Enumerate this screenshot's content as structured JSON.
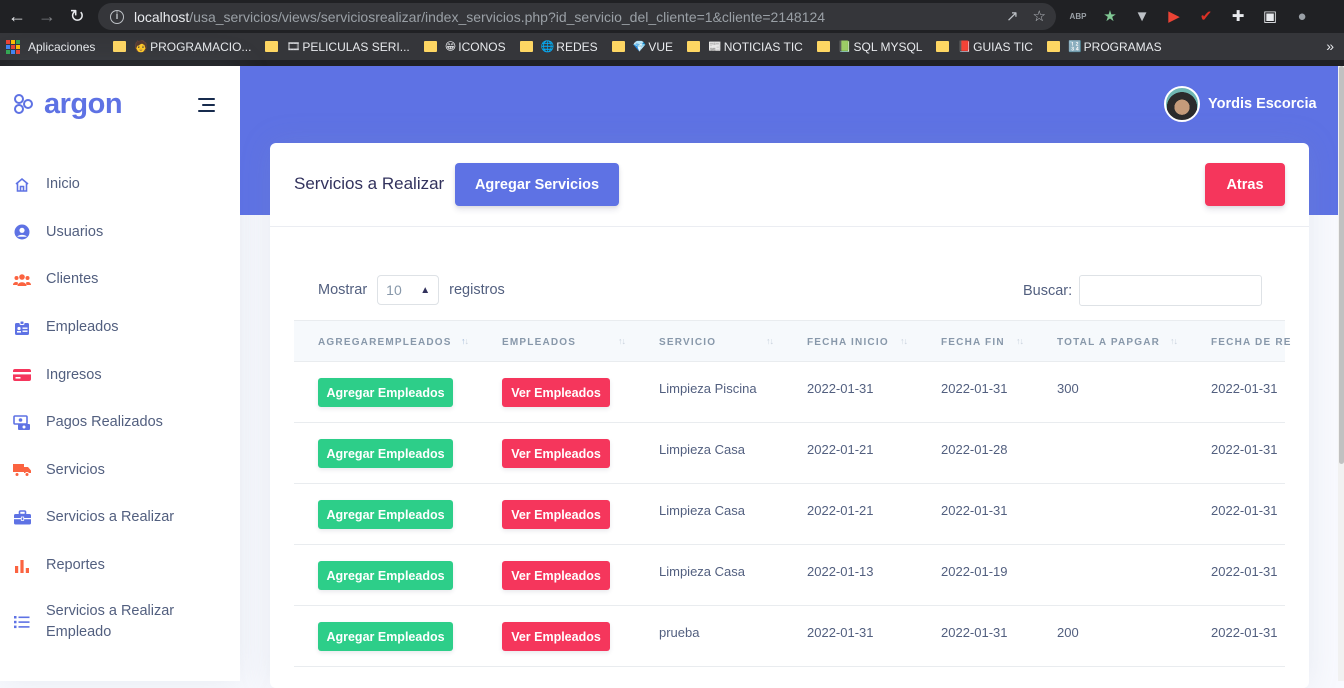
{
  "browser": {
    "url_host": "localhost",
    "url_path": "/usa_servicios/views/serviciosrealizar/index_servicios.php?id_servicio_del_cliente=1&cliente=2148124",
    "extensions": [
      {
        "name": "adblock-icon",
        "color": "#9aa0a6",
        "text": "ABP"
      },
      {
        "name": "star-extension-icon",
        "color": "#81c995",
        "text": "★"
      },
      {
        "name": "vue-devtools-icon",
        "color": "#bdc1c6",
        "text": "▼"
      },
      {
        "name": "video-extension-icon",
        "color": "#ea4335",
        "text": "▶"
      },
      {
        "name": "todo-extension-icon",
        "color": "#d93025",
        "text": "✔"
      },
      {
        "name": "puzzle-icon",
        "color": "#e8eaed",
        "text": "✚"
      },
      {
        "name": "sidepanel-icon",
        "color": "#e8eaed",
        "text": "▣"
      },
      {
        "name": "profile-icon",
        "color": "#9aa0a6",
        "text": "●"
      }
    ],
    "bookmarks": [
      {
        "label": "PROGRAMACIO...",
        "emoji": "🧑"
      },
      {
        "label": "PELICULAS SERI...",
        "emoji": "🎞"
      },
      {
        "label": "ICONOS",
        "emoji": "😁"
      },
      {
        "label": "REDES",
        "emoji": "🌐"
      },
      {
        "label": "VUE",
        "emoji": "💎"
      },
      {
        "label": "NOTICIAS TIC",
        "emoji": "📰"
      },
      {
        "label": "SQL MYSQL",
        "emoji": "📗"
      },
      {
        "label": "GUIAS TIC",
        "emoji": "📕"
      },
      {
        "label": "PROGRAMAS",
        "emoji": "🔢"
      }
    ],
    "apps_label": "Aplicaciones"
  },
  "brand": {
    "name": "argon"
  },
  "sidebar": {
    "items": [
      {
        "label": "Inicio",
        "icon": "home-icon",
        "color": "#5e72e4"
      },
      {
        "label": "Usuarios",
        "icon": "user-circle-icon",
        "color": "#5e72e4"
      },
      {
        "label": "Clientes",
        "icon": "users-icon",
        "color": "#fb6340"
      },
      {
        "label": "Empleados",
        "icon": "id-badge-icon",
        "color": "#5e72e4"
      },
      {
        "label": "Ingresos",
        "icon": "credit-card-icon",
        "color": "#f5365c"
      },
      {
        "label": "Pagos Realizados",
        "icon": "money-transfer-icon",
        "color": "#5e72e4"
      },
      {
        "label": "Servicios",
        "icon": "truck-icon",
        "color": "#fb6340"
      },
      {
        "label": "Servicios a Realizar",
        "icon": "briefcase-icon",
        "color": "#5e72e4"
      },
      {
        "label": "Reportes",
        "icon": "bar-chart-icon",
        "color": "#fb6340"
      },
      {
        "label": "Servicios a Realizar Empleado",
        "icon": "list-icon",
        "color": "#5e72e4"
      }
    ]
  },
  "header": {
    "user_name": "Yordis Escorcia"
  },
  "card": {
    "title": "Servicios a Realizar",
    "add_button": "Agregar Servicios",
    "back_button": "Atras",
    "show_label": "Mostrar",
    "page_length": "10",
    "records_label": "registros",
    "search_label": "Buscar:",
    "search_value": ""
  },
  "table": {
    "columns": [
      "AgregarEmpleados",
      "Empleados",
      "Servicio",
      "Fecha Inicio",
      "Fecha Fin",
      "Total a Papgar",
      "Fecha de Re"
    ],
    "add_employee_label": "Agregar Empleados",
    "view_employee_label": "Ver Empleados",
    "rows": [
      {
        "servicio": "Limpieza Piscina",
        "fecha_inicio": "2022-01-31",
        "fecha_fin": "2022-01-31",
        "total": "300",
        "fecha_re": "2022-01-31"
      },
      {
        "servicio": "Limpieza Casa",
        "fecha_inicio": "2022-01-21",
        "fecha_fin": "2022-01-28",
        "total": "",
        "fecha_re": "2022-01-31"
      },
      {
        "servicio": "Limpieza Casa",
        "fecha_inicio": "2022-01-21",
        "fecha_fin": "2022-01-31",
        "total": "",
        "fecha_re": "2022-01-31"
      },
      {
        "servicio": "Limpieza Casa",
        "fecha_inicio": "2022-01-13",
        "fecha_fin": "2022-01-19",
        "total": "",
        "fecha_re": "2022-01-31"
      },
      {
        "servicio": "prueba",
        "fecha_inicio": "2022-01-31",
        "fecha_fin": "2022-01-31",
        "total": "200",
        "fecha_re": "2022-01-31"
      }
    ]
  }
}
